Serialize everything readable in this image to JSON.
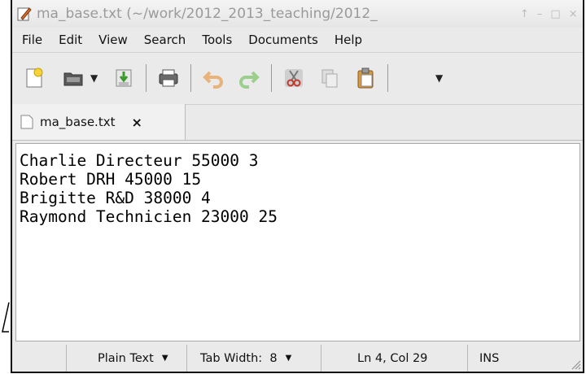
{
  "window": {
    "title": "ma_base.txt (~/work/2012_2013_teaching/2012_",
    "controls": [
      "↑",
      "–",
      "□",
      "×"
    ]
  },
  "menubar": {
    "items": [
      "File",
      "Edit",
      "View",
      "Search",
      "Tools",
      "Documents",
      "Help"
    ]
  },
  "toolbar": {
    "buttons": [
      "new-document-icon",
      "open-folder-icon",
      "save-icon",
      "print-icon",
      "undo-icon",
      "redo-icon",
      "cut-icon",
      "copy-icon",
      "paste-icon"
    ],
    "overflow_glyph": "▼"
  },
  "tab": {
    "label": "ma_base.txt",
    "close": "×"
  },
  "editor": {
    "lines": [
      "Charlie Directeur 55000 3",
      "Robert DRH 45000 15",
      "Brigitte R&D 38000 4",
      "Raymond Technicien 23000 25"
    ]
  },
  "statusbar": {
    "language": "Plain Text",
    "tab_width": "Tab Width:  8",
    "position": "Ln 4, Col 29",
    "mode": "INS",
    "caret": "▼"
  },
  "colors": {
    "window_bg": "#eaeaea",
    "editor_bg": "#ffffff",
    "title_text": "#9a9a9a",
    "undo_redo": "#e8b37a"
  }
}
